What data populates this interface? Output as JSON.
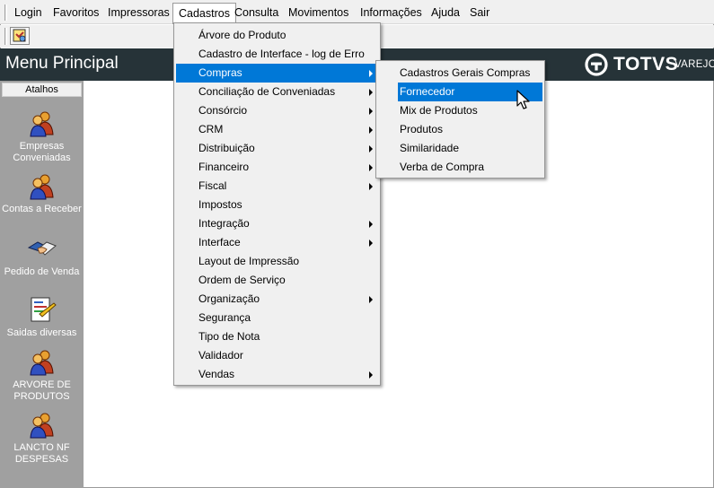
{
  "menubar": {
    "items": [
      "Login",
      "Favoritos",
      "Impressoras",
      "Cadastros",
      "Consulta",
      "Movimentos",
      "Informações",
      "Ajuda",
      "Sair"
    ],
    "active": "Cadastros"
  },
  "toolbar": {
    "button_icon": "favorites-icon"
  },
  "header": {
    "title": "Menu Principal",
    "logo_word": "TOTVS",
    "logo_sub": "VAREJO"
  },
  "sidebar": {
    "tab": "Atalhos",
    "items": [
      {
        "label": "Empresas Conveniadas",
        "icon": "people-icon"
      },
      {
        "label": "Contas a Receber",
        "icon": "people-icon"
      },
      {
        "label": "Pedido de Venda",
        "icon": "handshake-icon"
      },
      {
        "label": "Saidas diversas",
        "icon": "document-icon"
      },
      {
        "label": "ARVORE DE PRODUTOS",
        "icon": "people-icon"
      },
      {
        "label": "LANCTO NF DESPESAS",
        "icon": "people-icon"
      }
    ]
  },
  "cadastros_menu": {
    "items": [
      {
        "label": "Árvore do Produto",
        "submenu": false
      },
      {
        "label": "Cadastro de Interface - log de Erro",
        "submenu": false
      },
      {
        "label": "Compras",
        "submenu": true,
        "highlighted": true
      },
      {
        "label": "Conciliação de Conveniadas",
        "submenu": true
      },
      {
        "label": "Consórcio",
        "submenu": true
      },
      {
        "label": "CRM",
        "submenu": true
      },
      {
        "label": "Distribuição",
        "submenu": true
      },
      {
        "label": "Financeiro",
        "submenu": true
      },
      {
        "label": "Fiscal",
        "submenu": true
      },
      {
        "label": "Impostos",
        "submenu": false
      },
      {
        "label": "Integração",
        "submenu": true
      },
      {
        "label": "Interface",
        "submenu": true
      },
      {
        "label": "Layout de Impressão",
        "submenu": false
      },
      {
        "label": "Ordem de Serviço",
        "submenu": false
      },
      {
        "label": "Organização",
        "submenu": true
      },
      {
        "label": "Segurança",
        "submenu": false
      },
      {
        "label": "Tipo de Nota",
        "submenu": false
      },
      {
        "label": "Validador",
        "submenu": false
      },
      {
        "label": "Vendas",
        "submenu": true
      }
    ]
  },
  "compras_menu": {
    "items": [
      {
        "label": "Cadastros Gerais Compras"
      },
      {
        "label": "Fornecedor",
        "highlighted": true
      },
      {
        "label": "Mix de Produtos"
      },
      {
        "label": "Produtos"
      },
      {
        "label": "Similaridade"
      },
      {
        "label": "Verba de Compra"
      }
    ]
  },
  "colors": {
    "header_bg": "#263338",
    "sidebar_bg": "#a0a0a0",
    "highlight": "#0078d7"
  }
}
